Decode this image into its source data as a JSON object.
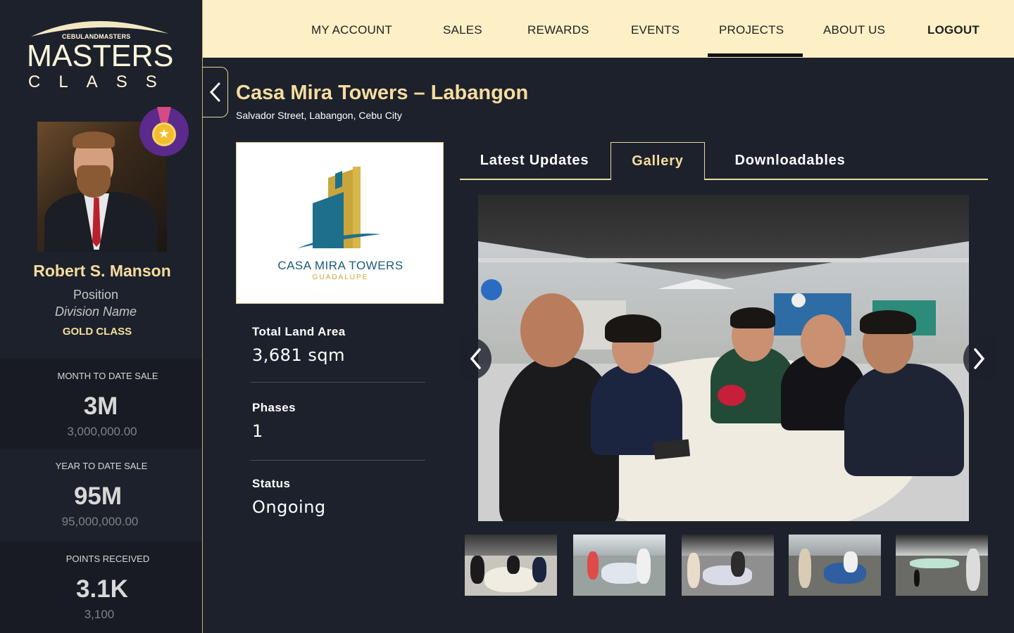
{
  "brand": {
    "small": "CEBULANDMASTERS",
    "masters": "MASTERS",
    "class": "CLASS"
  },
  "user": {
    "name": "Robert S. Manson",
    "position": "Position",
    "division": "Division Name",
    "tier": "GOLD CLASS"
  },
  "stats": [
    {
      "label": "MONTH TO DATE SALE",
      "big": "3M",
      "exact": "3,000,000.00"
    },
    {
      "label": "YEAR TO DATE SALE",
      "big": "95M",
      "exact": "95,000,000.00"
    },
    {
      "label": "POINTS RECEIVED",
      "big": "3.1K",
      "exact": "3,100"
    }
  ],
  "nav": {
    "items": [
      "MY ACCOUNT",
      "SALES",
      "REWARDS",
      "EVENTS",
      "PROJECTS",
      "ABOUT US",
      "LOGOUT"
    ],
    "active": "PROJECTS"
  },
  "project": {
    "title": "Casa Mira Towers – Labangon",
    "address": "Salvador Street, Labangon, Cebu City",
    "logo_text": "CASA MIRA TOWERS",
    "logo_sub": "GUADALUPE",
    "details": [
      {
        "label": "Total Land Area",
        "value": "3,681 sqm"
      },
      {
        "label": "Phases",
        "value": "1"
      },
      {
        "label": "Status",
        "value": "Ongoing"
      }
    ]
  },
  "tabs": {
    "items": [
      "Latest Updates",
      "Gallery",
      "Downloadables"
    ],
    "active": "Gallery"
  },
  "icons": {
    "back": "chevron-left-icon",
    "prev": "chevron-left-icon",
    "next": "chevron-right-icon",
    "medal": "medal-icon"
  },
  "colors": {
    "accent_gold": "#f6dd9f",
    "nav_bg": "#fdf0c7",
    "page_bg": "#1d212b",
    "medal_purple": "#5b2a8c"
  }
}
